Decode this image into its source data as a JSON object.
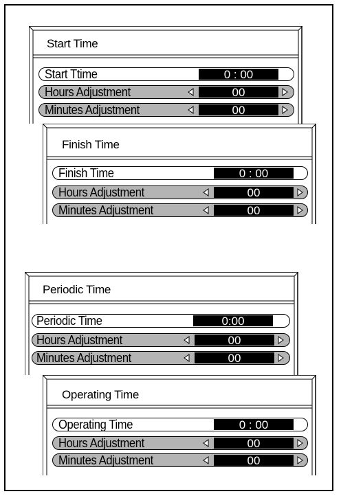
{
  "panels": [
    {
      "title": "Start Time",
      "rows": [
        {
          "label": "Start Ttime",
          "value": "0 : 00"
        },
        {
          "label": "Hours Adjustment",
          "value": "00"
        },
        {
          "label": "Minutes Adjustment",
          "value": "00"
        }
      ]
    },
    {
      "title": "Finish Time",
      "rows": [
        {
          "label": "Finish Time",
          "value": "0 : 00"
        },
        {
          "label": "Hours Adjustment",
          "value": "00"
        },
        {
          "label": "Minutes Adjustment",
          "value": "00"
        }
      ]
    },
    {
      "title": "Periodic Time",
      "rows": [
        {
          "label": "Periodic Time",
          "value": "0:00"
        },
        {
          "label": "Hours Adjustment",
          "value": "00"
        },
        {
          "label": "Minutes Adjustment",
          "value": "00"
        }
      ]
    },
    {
      "title": "Operating Time",
      "rows": [
        {
          "label": "Operating Time",
          "value": "0 : 00"
        },
        {
          "label": "Hours Adjustment",
          "value": "00"
        },
        {
          "label": "Minutes Adjustment",
          "value": "00"
        }
      ]
    }
  ]
}
